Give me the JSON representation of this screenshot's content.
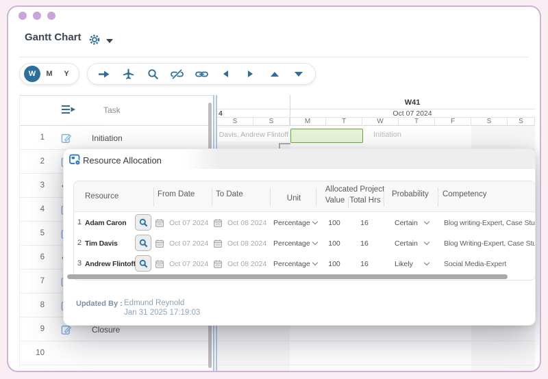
{
  "window": {
    "title": "Gantt Chart"
  },
  "toolbar": {
    "views": [
      "W",
      "M",
      "Y"
    ],
    "selected_view": "W",
    "icons": [
      "arrow-right",
      "plane",
      "search",
      "unlink",
      "link",
      "caret-left",
      "caret-right",
      "caret-up",
      "caret-down"
    ]
  },
  "task_table": {
    "task_header": "Task",
    "rows": [
      {
        "num": "1",
        "icon": "edit",
        "task": "Initiation"
      },
      {
        "num": "2",
        "icon": "edit",
        "task": ""
      },
      {
        "num": "3",
        "icon": "milestone",
        "task": ""
      },
      {
        "num": "4",
        "icon": "edit",
        "task": ""
      },
      {
        "num": "5",
        "icon": "edit",
        "task": ""
      },
      {
        "num": "6",
        "icon": "milestone",
        "task": ""
      },
      {
        "num": "7",
        "icon": "edit",
        "task": ""
      },
      {
        "num": "8",
        "icon": "edit",
        "task": ""
      },
      {
        "num": "9",
        "icon": "edit",
        "task": "Closure"
      },
      {
        "num": "10",
        "icon": "",
        "task": ""
      }
    ]
  },
  "timeline": {
    "week_label": "W41",
    "date_label": "Oct 07 2024",
    "prev_date_fragment": "4",
    "days": [
      "S",
      "S",
      "M",
      "T",
      "W",
      "T",
      "F",
      "S",
      "S"
    ],
    "row1": {
      "resources": "Tim Davis, Andrew Flintoff",
      "bar_label": "Initiation"
    },
    "bar_fill": "#e9f5da",
    "bar_border": "#68a53c"
  },
  "modal": {
    "title": "Resource Allocation",
    "table": {
      "headers": {
        "resource": "Resource",
        "from": "From Date",
        "to": "To Date",
        "unit": "Unit",
        "allocated": "Allocated Project",
        "value": "Value",
        "total_hrs": "Total Hrs",
        "probability": "Probability",
        "competency": "Competency"
      },
      "rows": [
        {
          "num": "1",
          "resource": "Adam Caron",
          "from": "Oct 07 2024",
          "to": "Oct 08 2024",
          "unit": "Percentage",
          "value": "100",
          "total_hrs": "16",
          "probability": "Certain",
          "competency": "Blog writing-Expert, Case Studies"
        },
        {
          "num": "2",
          "resource": "Tim Davis",
          "from": "Oct 07 2024",
          "to": "Oct 08 2024",
          "unit": "Percentage",
          "value": "100",
          "total_hrs": "16",
          "probability": "Certain",
          "competency": "Blog Writing-Expert, Case Studies"
        },
        {
          "num": "3",
          "resource": "Andrew Flintoff",
          "from": "Oct 07 2024",
          "to": "Oct 08 2024",
          "unit": "Percentage",
          "value": "100",
          "total_hrs": "16",
          "probability": "Likely",
          "competency": "Social Media-Expert"
        }
      ]
    },
    "updated_by_label": "Updated By :",
    "updated_by_name": "Edmund Reynold",
    "updated_at": "Jan 31 2025 17:19:03"
  }
}
